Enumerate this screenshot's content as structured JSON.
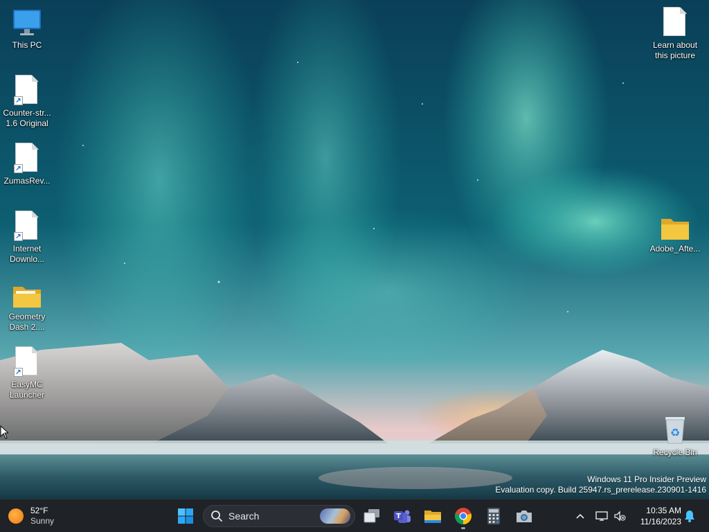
{
  "desktop": {
    "left_icons": [
      {
        "name": "this-pc",
        "label": "This PC",
        "icon": "monitor-icon"
      },
      {
        "name": "counter-strike",
        "label": "Counter-str...\n1.6 Original",
        "icon": "file-shortcut-icon"
      },
      {
        "name": "zumas-revenge",
        "label": "ZumasRev...",
        "icon": "file-shortcut-icon"
      },
      {
        "name": "internet-download",
        "label": "Internet\nDownlo...",
        "icon": "file-shortcut-icon"
      },
      {
        "name": "geometry-dash",
        "label": "Geometry\nDash 2....",
        "icon": "folder-icon"
      },
      {
        "name": "easymc",
        "label": "EasyMC\nLauncher",
        "icon": "file-shortcut-icon"
      }
    ],
    "right_icons": [
      {
        "name": "learn-about-picture",
        "label": "Learn about\nthis picture",
        "icon": "file-icon"
      },
      {
        "name": "adobe-after",
        "label": "Adobe_Afte...",
        "icon": "folder-icon"
      },
      {
        "name": "recycle-bin",
        "label": "Recycle Bin",
        "icon": "recycle-bin-icon"
      }
    ]
  },
  "watermark": {
    "line1": "Windows 11 Pro Insider Preview",
    "line2": "Evaluation copy. Build 25947.rs_prerelease.230901-1416"
  },
  "taskbar": {
    "weather": {
      "temp": "52°F",
      "condition": "Sunny",
      "icon": "sun-icon"
    },
    "search": {
      "label": "Search",
      "icon": "search-icon"
    },
    "apps": [
      {
        "name": "start",
        "icon": "windows-logo-icon"
      },
      {
        "name": "task-view",
        "icon": "task-view-icon"
      },
      {
        "name": "teams",
        "icon": "teams-icon"
      },
      {
        "name": "file-explorer",
        "icon": "folder-icon"
      },
      {
        "name": "chrome",
        "icon": "chrome-icon",
        "running": true
      },
      {
        "name": "calculator",
        "icon": "calculator-icon"
      },
      {
        "name": "camera",
        "icon": "camera-icon"
      }
    ],
    "tray": {
      "chevron_icon": "chevron-up-icon",
      "network_icon": "network-icon",
      "volume_icon": "volume-muted-icon",
      "time": "10:35 AM",
      "date": "11/16/2023",
      "notification_icon": "bell-icon"
    }
  },
  "colors": {
    "taskbar_bg": "#1f2227",
    "aurora_teal": "#2fd3c0",
    "sky_dark": "#0b3a52",
    "folder_yellow": "#f3c73f",
    "accent_blue": "#2a8ae6"
  }
}
